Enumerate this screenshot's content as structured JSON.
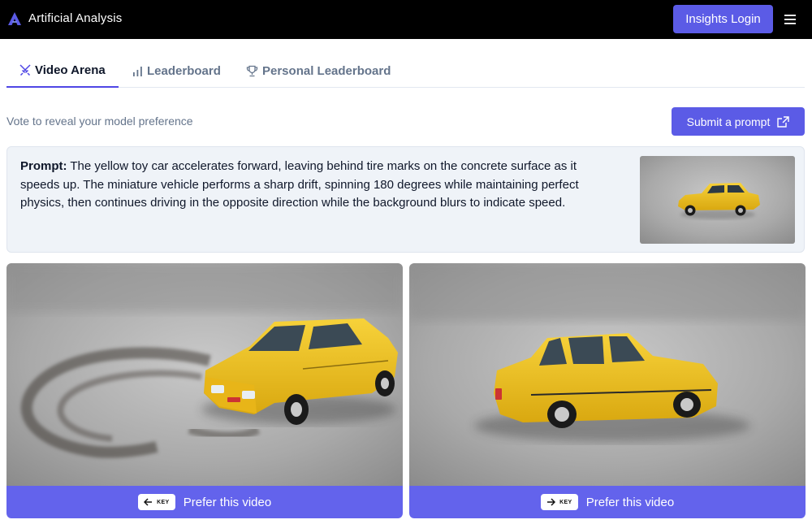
{
  "header": {
    "brand": "Artificial Analysis",
    "login_label": "Insights Login",
    "logo_icon": "triangle-logo-icon",
    "menu_icon": "hamburger-menu-icon"
  },
  "tabs": [
    {
      "label": "Video Arena",
      "icon": "swords-icon",
      "active": true
    },
    {
      "label": "Leaderboard",
      "icon": "bar-chart-icon",
      "active": false
    },
    {
      "label": "Personal Leaderboard",
      "icon": "trophy-icon",
      "active": false
    }
  ],
  "subheader": {
    "vote_text": "Vote to reveal your model preference",
    "submit_label": "Submit a prompt",
    "submit_icon": "share-icon"
  },
  "prompt": {
    "label": "Prompt:",
    "text": " The yellow toy car accelerates forward, leaving behind tire marks on the concrete surface as it speeds up. The miniature vehicle performs a sharp drift, spinning 180 degrees while maintaining perfect physics, then continues driving in the opposite direction while the background blurs to indicate speed."
  },
  "videos": [
    {
      "prefer_label": "Prefer this video",
      "key_label": "KEY",
      "key_icon": "arrow-left-icon"
    },
    {
      "prefer_label": "Prefer this video",
      "key_label": "KEY",
      "key_icon": "arrow-right-icon"
    }
  ],
  "colors": {
    "accent": "#5b5be6",
    "prefer_bar": "#6363ec",
    "topbar": "#000000",
    "car_yellow": "#f2c21b"
  }
}
